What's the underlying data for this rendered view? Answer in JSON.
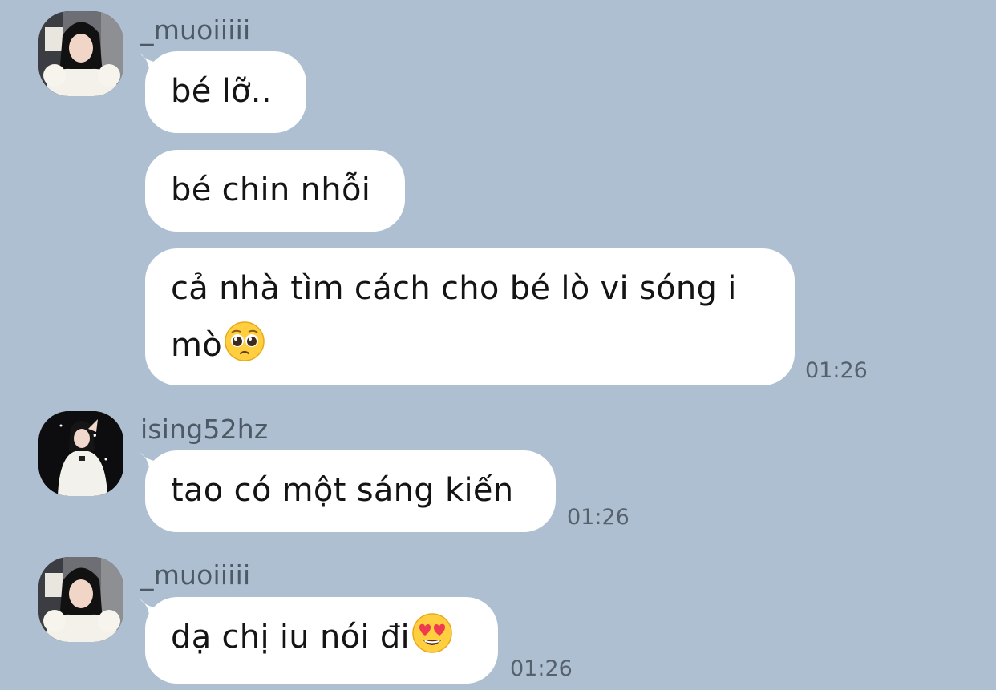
{
  "colors": {
    "background": "#adbfd1",
    "bubble": "#ffffff",
    "sender_text": "#4d5a66",
    "time_text": "#56616c"
  },
  "messages": [
    {
      "sender": "_muoiiiii",
      "avatar_icon": "avatar-muoiiiii",
      "bubbles": [
        {
          "text": "bé lỡ..",
          "emoji": null
        },
        {
          "text": "bé chin nhỗi",
          "emoji": null
        },
        {
          "text": "cả nhà tìm cách cho bé lò vi sóng i mò",
          "emoji": "pleading-face-emoji"
        }
      ],
      "time": "01:26"
    },
    {
      "sender": "ising52hz",
      "avatar_icon": "avatar-ising52hz",
      "bubbles": [
        {
          "text": "tao có một sáng kiến",
          "emoji": null
        }
      ],
      "time": "01:26"
    },
    {
      "sender": "_muoiiiii",
      "avatar_icon": "avatar-muoiiiii",
      "bubbles": [
        {
          "text": "dạ chị iu nói đi",
          "emoji": "heart-eyes-emoji"
        }
      ],
      "time": "01:26"
    }
  ]
}
